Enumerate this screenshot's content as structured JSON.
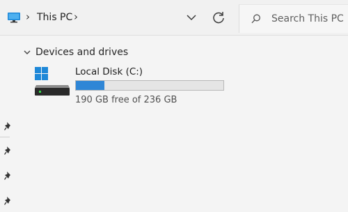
{
  "breadcrumb": {
    "separator": "›",
    "location": "This PC",
    "icons": {
      "location": "computer-monitor-icon",
      "dropdown": "chevron-down-icon",
      "refresh": "refresh-icon"
    }
  },
  "search": {
    "placeholder": "Search This PC",
    "icon": "search-icon"
  },
  "main": {
    "group": {
      "label": "Devices and drives",
      "expanded": true
    },
    "drives": [
      {
        "name": "Local Disk (C:)",
        "free_text": "190 GB free of 236 GB",
        "free_gb": 190,
        "total_gb": 236,
        "used_fraction": 0.195,
        "icon": "windows-drive-icon"
      }
    ]
  },
  "nav": {
    "pins": [
      "pin-icon",
      "pin-icon",
      "pin-icon",
      "pin-icon"
    ]
  },
  "colors": {
    "accent": "#2f86d6",
    "background": "#f4f4f4",
    "bar_track": "#e5e5e5"
  }
}
